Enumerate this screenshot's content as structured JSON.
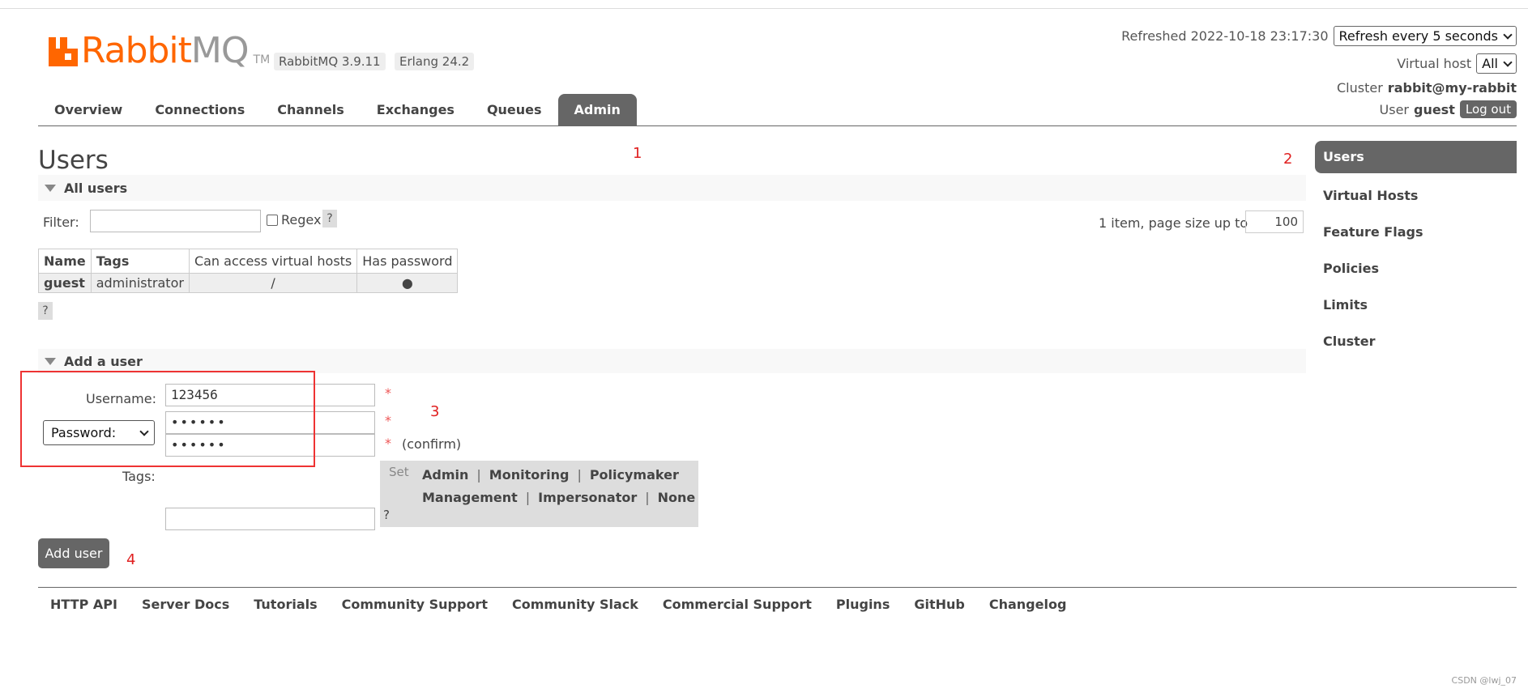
{
  "header": {
    "logo_rabbit": "Rabbit",
    "logo_mq": "MQ",
    "logo_tm": "TM",
    "version_rabbit": "RabbitMQ 3.9.11",
    "version_erlang": "Erlang 24.2",
    "refreshed_label": "Refreshed 2022-10-18 23:17:30",
    "refresh_select": "Refresh every 5 seconds",
    "vhost_label": "Virtual host",
    "vhost_select": "All",
    "cluster_label": "Cluster",
    "cluster_name": "rabbit@my-rabbit",
    "user_label": "User",
    "user_name": "guest",
    "logout": "Log out"
  },
  "tabs": [
    "Overview",
    "Connections",
    "Channels",
    "Exchanges",
    "Queues",
    "Admin"
  ],
  "active_tab": "Admin",
  "main": {
    "title": "Users",
    "all_users": {
      "header": "All users",
      "filter_label": "Filter:",
      "regex_label": "Regex",
      "help": "?",
      "page_info": "1 item, page size up to",
      "page_size": "100",
      "columns": [
        "Name",
        "Tags",
        "Can access virtual hosts",
        "Has password"
      ],
      "rows": [
        {
          "name": "guest",
          "tags": "administrator",
          "vhosts": "/",
          "has_password": "●"
        }
      ]
    },
    "add_user": {
      "header": "Add a user",
      "username_label": "Username:",
      "username_value": "123456",
      "password_select": "Password:",
      "password_value": "••••••",
      "confirm_value": "••••••",
      "required": "*",
      "confirm_label": "(confirm)",
      "tags_label": "Tags:",
      "tags_value": "",
      "set_label": "Set",
      "tags_row1": [
        "Admin",
        "Monitoring",
        "Policymaker"
      ],
      "tags_row2": [
        "Management",
        "Impersonator",
        "None"
      ],
      "separator": "|",
      "help": "?",
      "button": "Add user"
    }
  },
  "sidebar": [
    "Users",
    "Virtual Hosts",
    "Feature Flags",
    "Policies",
    "Limits",
    "Cluster"
  ],
  "annotations": [
    "1",
    "2",
    "3",
    "4"
  ],
  "footer": [
    "HTTP API",
    "Server Docs",
    "Tutorials",
    "Community Support",
    "Community Slack",
    "Commercial Support",
    "Plugins",
    "GitHub",
    "Changelog"
  ],
  "watermark": "CSDN @lwj_07",
  "colors": {
    "brand_orange": "#ff6600",
    "dark_gray": "#666666",
    "annotation_red": "#e02020"
  }
}
